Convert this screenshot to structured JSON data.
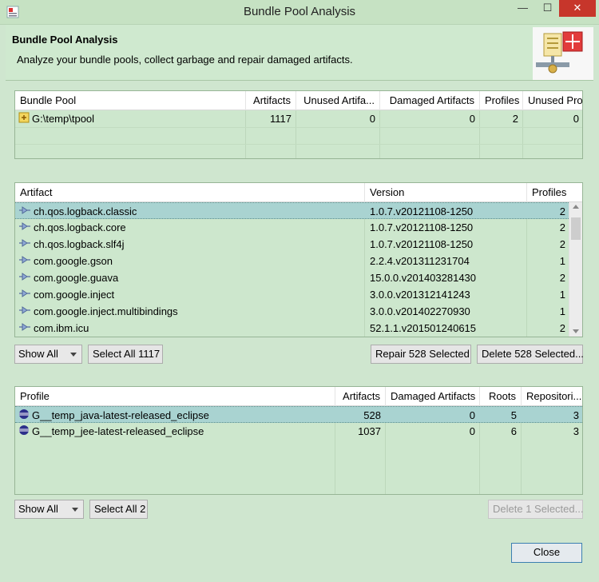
{
  "window": {
    "title": "Bundle Pool Analysis",
    "minimize": "—",
    "maximize": "☐",
    "close": "✕"
  },
  "header": {
    "title": "Bundle Pool Analysis",
    "description": "Analyze your bundle pools, collect garbage and repair damaged artifacts."
  },
  "pools": {
    "columns": [
      "Bundle Pool",
      "Artifacts",
      "Unused Artifa...",
      "Damaged Artifacts",
      "Profiles",
      "Unused Profi..."
    ],
    "rows": [
      {
        "name": "G:\\temp\\tpool",
        "artifacts": "1117",
        "unused_artifacts": "0",
        "damaged": "0",
        "profiles": "2",
        "unused_profiles": "0"
      }
    ]
  },
  "artifacts": {
    "columns": [
      "Artifact",
      "Version",
      "Profiles"
    ],
    "rows": [
      {
        "name": "ch.qos.logback.classic",
        "version": "1.0.7.v20121108-1250",
        "profiles": "2"
      },
      {
        "name": "ch.qos.logback.core",
        "version": "1.0.7.v20121108-1250",
        "profiles": "2"
      },
      {
        "name": "ch.qos.logback.slf4j",
        "version": "1.0.7.v20121108-1250",
        "profiles": "2"
      },
      {
        "name": "com.google.gson",
        "version": "2.2.4.v201311231704",
        "profiles": "1"
      },
      {
        "name": "com.google.guava",
        "version": "15.0.0.v201403281430",
        "profiles": "2"
      },
      {
        "name": "com.google.inject",
        "version": "3.0.0.v201312141243",
        "profiles": "1"
      },
      {
        "name": "com.google.inject.multibindings",
        "version": "3.0.0.v201402270930",
        "profiles": "1"
      },
      {
        "name": "com.ibm.icu",
        "version": "52.1.1.v201501240615",
        "profiles": "2"
      }
    ],
    "filter": "Show All",
    "select_all": "Select All 1117",
    "repair": "Repair 528 Selected",
    "delete": "Delete 528 Selected..."
  },
  "profiles": {
    "columns": [
      "Profile",
      "Artifacts",
      "Damaged Artifacts",
      "Roots",
      "Repositori..."
    ],
    "rows": [
      {
        "name": "G__temp_java-latest-released_eclipse",
        "artifacts": "528",
        "damaged": "0",
        "roots": "5",
        "repositories": "3"
      },
      {
        "name": "G__temp_jee-latest-released_eclipse",
        "artifacts": "1037",
        "damaged": "0",
        "roots": "6",
        "repositories": "3"
      }
    ],
    "filter": "Show All",
    "select_all": "Select All 2",
    "delete": "Delete 1 Selected..."
  },
  "footer": {
    "close": "Close"
  },
  "colors": {
    "background": "#cfe6cf",
    "selection": "#a9d3d1",
    "close_button": "#c7362b"
  }
}
